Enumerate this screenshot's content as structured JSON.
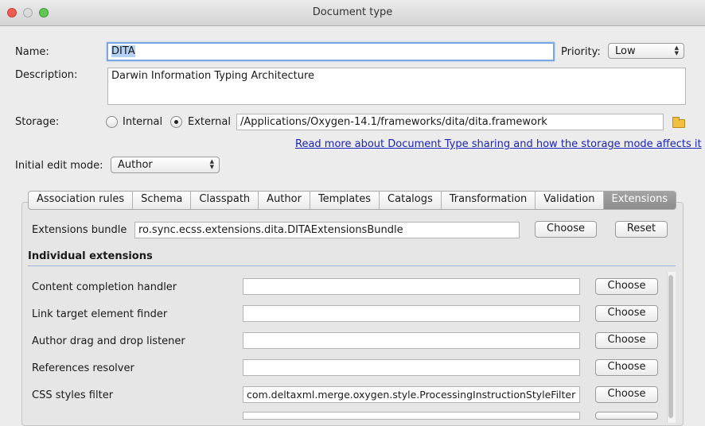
{
  "window": {
    "title": "Document type"
  },
  "form": {
    "name_label": "Name:",
    "name_value": "DITA",
    "priority_label": "Priority:",
    "priority_value": "Low",
    "description_label": "Description:",
    "description_value": "Darwin Information Typing Architecture",
    "storage_label": "Storage:",
    "storage_internal": "Internal",
    "storage_external": "External",
    "storage_selected": "External",
    "storage_path": "/Applications/Oxygen-14.1/frameworks/dita/dita.framework",
    "sharing_link": "Read more about Document Type sharing and how the storage mode affects it",
    "edit_mode_label": "Initial edit mode:",
    "edit_mode_value": "Author"
  },
  "tabs": [
    {
      "label": "Association rules"
    },
    {
      "label": "Schema"
    },
    {
      "label": "Classpath"
    },
    {
      "label": "Author"
    },
    {
      "label": "Templates"
    },
    {
      "label": "Catalogs"
    },
    {
      "label": "Transformation"
    },
    {
      "label": "Validation"
    },
    {
      "label": "Extensions",
      "active": true
    }
  ],
  "extensions": {
    "bundle_label": "Extensions bundle",
    "bundle_value": "ro.sync.ecss.extensions.dita.DITAExtensionsBundle",
    "choose_label": "Choose",
    "reset_label": "Reset",
    "individual_title": "Individual extensions",
    "rows": [
      {
        "label": "Content completion handler",
        "value": "",
        "button": "Choose"
      },
      {
        "label": "Link target element finder",
        "value": "",
        "button": "Choose"
      },
      {
        "label": "Author drag and drop listener",
        "value": "",
        "button": "Choose"
      },
      {
        "label": "References resolver",
        "value": "",
        "button": "Choose"
      },
      {
        "label": "CSS styles filter",
        "value": "com.deltaxml.merge.oxygen.style.ProcessingInstructionStyleFilter",
        "button": "Choose"
      }
    ]
  },
  "colors": {
    "link": "#1a24b8",
    "active_tab": "#9a9a9a",
    "focus": "#7aa7e0"
  }
}
